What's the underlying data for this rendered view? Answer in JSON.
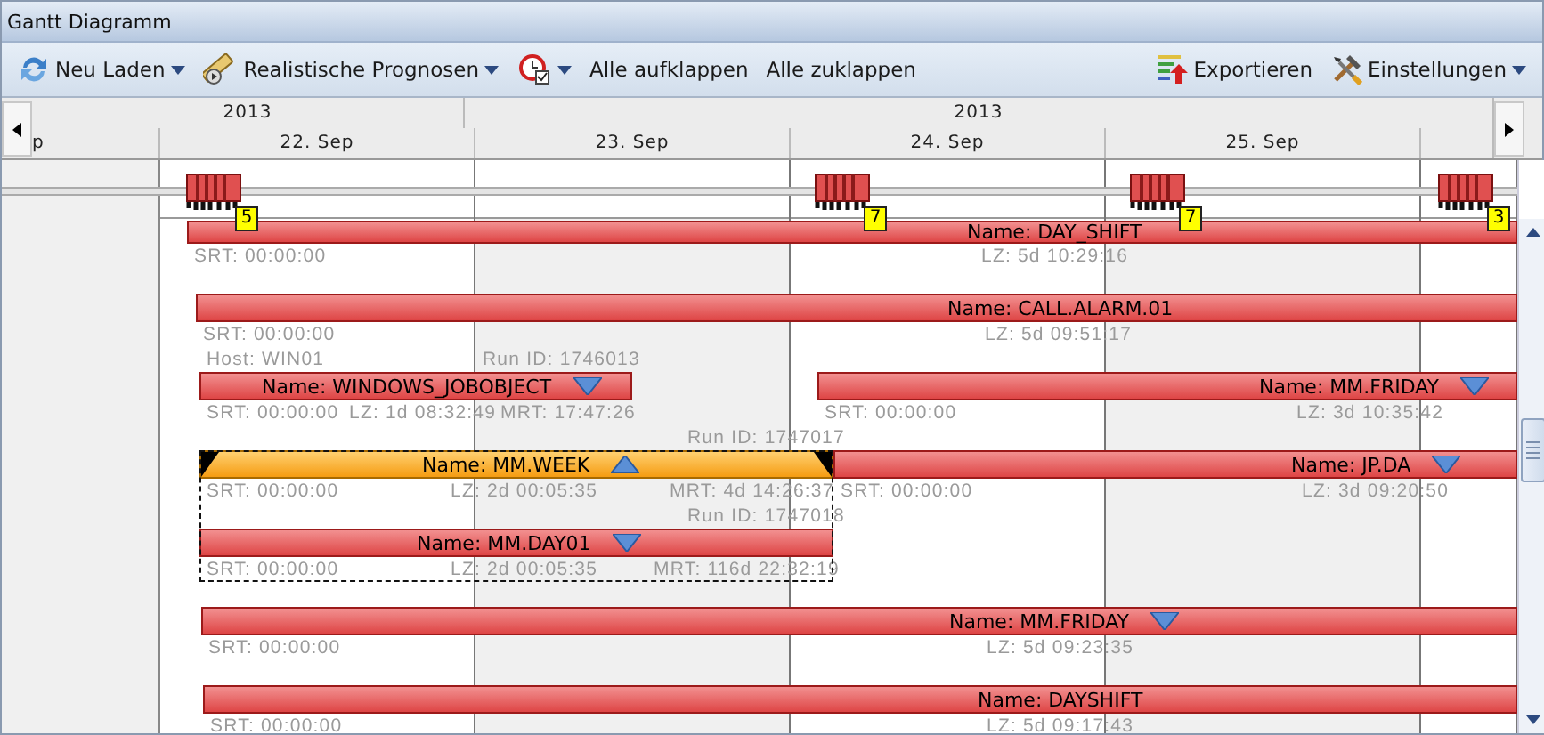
{
  "window": {
    "title": "Gantt Diagramm"
  },
  "toolbar": [
    {
      "kind": "reload",
      "label": "Neu Laden",
      "dropdown": true
    },
    {
      "kind": "forecast",
      "label": "Realistische Prognosen",
      "dropdown": true
    },
    {
      "kind": "alarm",
      "dropdown": true
    },
    {
      "kind": "action",
      "label": "Alle aufklappen",
      "dropdown": false
    },
    {
      "kind": "action",
      "label": "Alle zuklappen",
      "dropdown": false
    },
    {
      "kind": "export",
      "label": "Exportieren",
      "dropdown": false
    },
    {
      "kind": "settings",
      "label": "Einstellungen",
      "dropdown": true
    }
  ],
  "timeline": {
    "years": [
      "2013",
      "2013"
    ],
    "days": [
      "p",
      "22. Sep",
      "23. Sep",
      "24. Sep",
      "25. Sep"
    ]
  },
  "overview": [
    {
      "count": "5"
    },
    {
      "count": "7"
    },
    {
      "count": "7"
    },
    {
      "count": "3"
    }
  ],
  "rows": [
    {
      "tasks": [
        {
          "name": "Name: DAY_SHIFT",
          "srt": "SRT: 00:00:00",
          "lz": "LZ: 5d 10:29:16",
          "selected": false
        }
      ]
    },
    {
      "tasks": [
        {
          "name": "Name: CALL.ALARM.01",
          "srt": "SRT: 00:00:00",
          "lz": "LZ: 5d 09:51:17",
          "selected": false
        }
      ]
    },
    {
      "tasks": [
        {
          "name": "Name: WINDOWS_JOBOBJECT",
          "host": "Host: WIN01",
          "run_id": "Run ID: 1746013",
          "srt": "SRT: 00:00:00",
          "lz": "LZ: 1d 08:32:49",
          "mrt": "MRT: 17:47:26",
          "selected": false,
          "expanded": false
        },
        {
          "name": "Name: MM.FRIDAY",
          "srt": "SRT: 00:00:00",
          "lz": "LZ: 3d 10:35:42",
          "selected": false,
          "expanded": false
        }
      ]
    },
    {
      "tasks": [
        {
          "name": "Name: MM.WEEK",
          "run_id": "Run ID: 1747017",
          "srt": "SRT: 00:00:00",
          "lz": "LZ: 2d 00:05:35",
          "mrt": "MRT: 4d 14:26:37",
          "selected": true,
          "expanded": true,
          "children": [
            {
              "name": "Name: MM.DAY01",
              "run_id": "Run ID: 1747018",
              "srt": "SRT: 00:00:00",
              "lz": "LZ: 2d 00:05:35",
              "mrt": "MRT: 116d 22:32:19",
              "selected": false,
              "expanded": false
            }
          ]
        },
        {
          "name": "Name: JP.DA",
          "srt": "SRT: 00:00:00",
          "lz": "LZ: 3d 09:20:50",
          "selected": false,
          "expanded": false
        }
      ]
    },
    {
      "tasks": [
        {
          "name": "Name: MM.FRIDAY",
          "srt": "SRT: 00:00:00",
          "lz": "LZ: 5d 09:23:35",
          "selected": false,
          "expanded": false
        }
      ]
    },
    {
      "tasks": [
        {
          "name": "Name: DAYSHIFT",
          "srt": "SRT: 00:00:00",
          "lz": "LZ: 5d 09:17:43",
          "selected": false
        }
      ]
    }
  ]
}
